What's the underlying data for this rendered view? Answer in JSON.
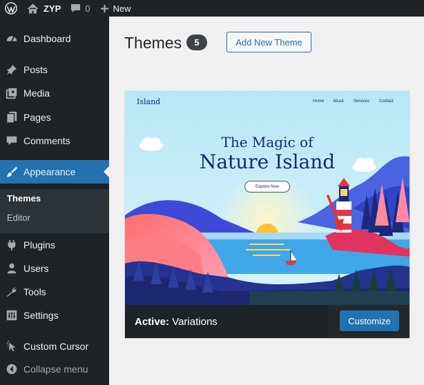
{
  "admin_bar": {
    "site_name": "ZYP",
    "comment_count": "0",
    "new_label": "New"
  },
  "sidebar": {
    "items": [
      {
        "label": "Dashboard",
        "icon": "dashboard-icon"
      },
      {
        "label": "Posts",
        "icon": "pin-icon"
      },
      {
        "label": "Media",
        "icon": "media-icon"
      },
      {
        "label": "Pages",
        "icon": "pages-icon"
      },
      {
        "label": "Comments",
        "icon": "comment-icon"
      },
      {
        "label": "Appearance",
        "icon": "brush-icon"
      },
      {
        "label": "Plugins",
        "icon": "plug-icon"
      },
      {
        "label": "Users",
        "icon": "user-icon"
      },
      {
        "label": "Tools",
        "icon": "wrench-icon"
      },
      {
        "label": "Settings",
        "icon": "settings-icon"
      },
      {
        "label": "Custom Cursor",
        "icon": "cursor-icon"
      }
    ],
    "submenu": [
      {
        "label": "Themes"
      },
      {
        "label": "Editor"
      }
    ],
    "collapse_label": "Collapse menu"
  },
  "main": {
    "title": "Themes",
    "count": "5",
    "add_new_label": "Add New Theme"
  },
  "theme": {
    "screenshot": {
      "brand": "Island",
      "nav": [
        "Home",
        "About",
        "Services",
        "Contact"
      ],
      "heading_line1": "The Magic of",
      "heading_line2": "Nature Island",
      "button": "Explore Now"
    },
    "active_prefix": "Active:",
    "name": "Variations",
    "customize_label": "Customize"
  },
  "colors": {
    "admin_bg": "#1d2327",
    "accent": "#2271b1",
    "page_bg": "#f0f0f1"
  }
}
